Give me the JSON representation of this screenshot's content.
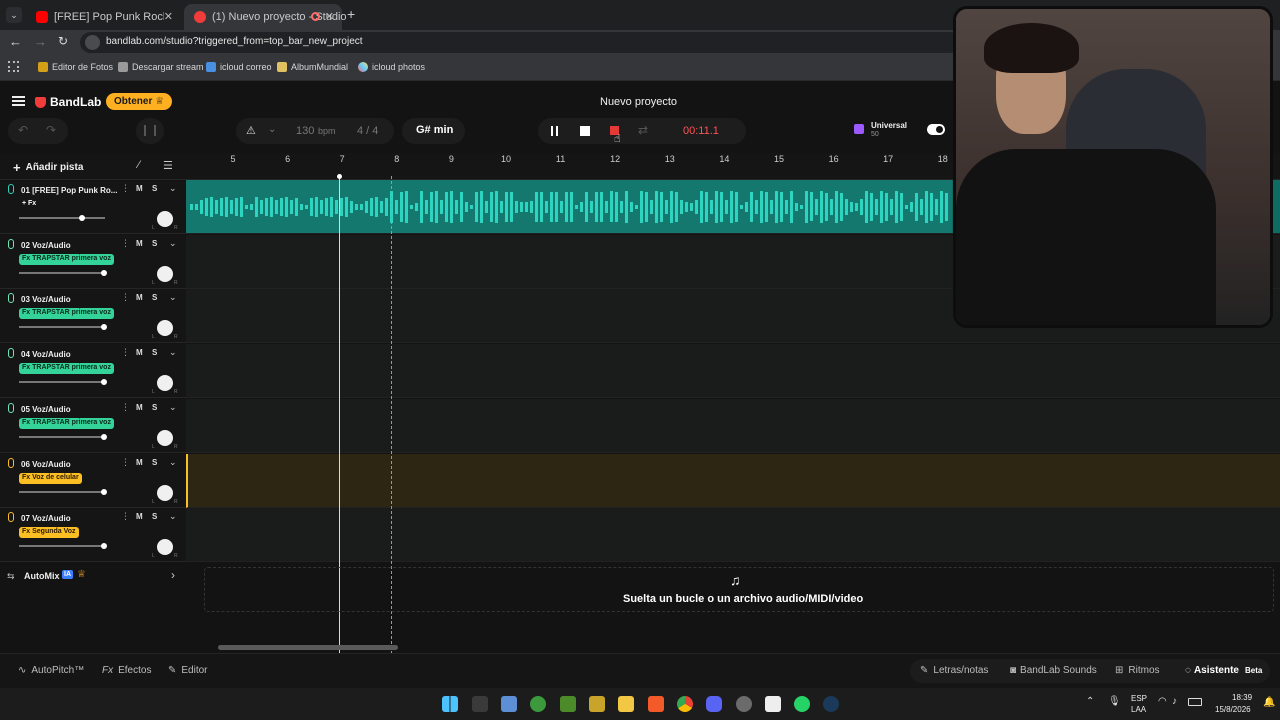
{
  "browser": {
    "tabs": [
      {
        "title": "[FREE] Pop Punk Rock Type Be",
        "icon": "youtube-icon",
        "active": false
      },
      {
        "title": "(1) Nuevo proyecto - Studio",
        "icon": "bandlab-icon",
        "active": true
      }
    ],
    "new_tab": "+",
    "url": "bandlab.com/studio?triggered_from=top_bar_new_project",
    "bookmarks": [
      "Editor de Fotos",
      "Descargar stream",
      "icloud correo",
      "AlbumMundial",
      "icloud photos"
    ]
  },
  "app": {
    "logo": "BandLab",
    "get_button": "Obtener",
    "project_title": "Nuevo proyecto",
    "bpm_value": "130",
    "bpm_unit": "bpm",
    "time_sig": "4 / 4",
    "key": "G# min",
    "time": "00:11.1",
    "universal_label": "Universal",
    "universal_count": "50",
    "add_track": "Añadir pista",
    "accent_color": "#2dd4bf",
    "record_color": "#e53935",
    "time_color": "#ff5252"
  },
  "ruler": [
    "5",
    "6",
    "7",
    "8",
    "9",
    "10",
    "11",
    "12",
    "13",
    "14",
    "15",
    "16",
    "17",
    "18"
  ],
  "tracks": [
    {
      "num": "01",
      "name": "[FREE] Pop Punk Ro...",
      "fx": "+ Fx",
      "fx_style": "plain",
      "color": "#2dd4bf"
    },
    {
      "num": "02",
      "name": "Voz/Audio",
      "fx": "Fx TRAPSTAR primera voz",
      "fx_style": "green",
      "color": "#6ee7b7"
    },
    {
      "num": "03",
      "name": "Voz/Audio",
      "fx": "Fx TRAPSTAR primera voz",
      "fx_style": "green",
      "color": "#6ee7b7"
    },
    {
      "num": "04",
      "name": "Voz/Audio",
      "fx": "Fx TRAPSTAR primera voz",
      "fx_style": "green",
      "color": "#6ee7b7"
    },
    {
      "num": "05",
      "name": "Voz/Audio",
      "fx": "Fx TRAPSTAR primera voz",
      "fx_style": "green",
      "color": "#6ee7b7"
    },
    {
      "num": "06",
      "name": "Voz/Audio",
      "fx": "Fx Voz de celular",
      "fx_style": "yellow",
      "color": "#fbbf24"
    },
    {
      "num": "07",
      "name": "Voz/Audio",
      "fx": "Fx Segunda Voz",
      "fx_style": "yellow",
      "color": "#fbbf24"
    }
  ],
  "track_buttons": {
    "mute": "M",
    "solo": "S"
  },
  "automix": {
    "label": "AutoMix",
    "badge": "IA"
  },
  "drop_zone": "Suelta un bucle o un archivo audio/MIDI/video",
  "bottom": {
    "autopitch": "AutoPitch™",
    "effects": "Efectos",
    "editor": "Editor",
    "lyrics": "Letras/notas",
    "sounds": "BandLab Sounds",
    "rhythms": "Ritmos",
    "assistant": "Asistente",
    "beta": "Beta"
  },
  "taskbar": {
    "lang": "ESP",
    "layout": "LAA",
    "time": "18:39",
    "date": "15/8/2026"
  }
}
